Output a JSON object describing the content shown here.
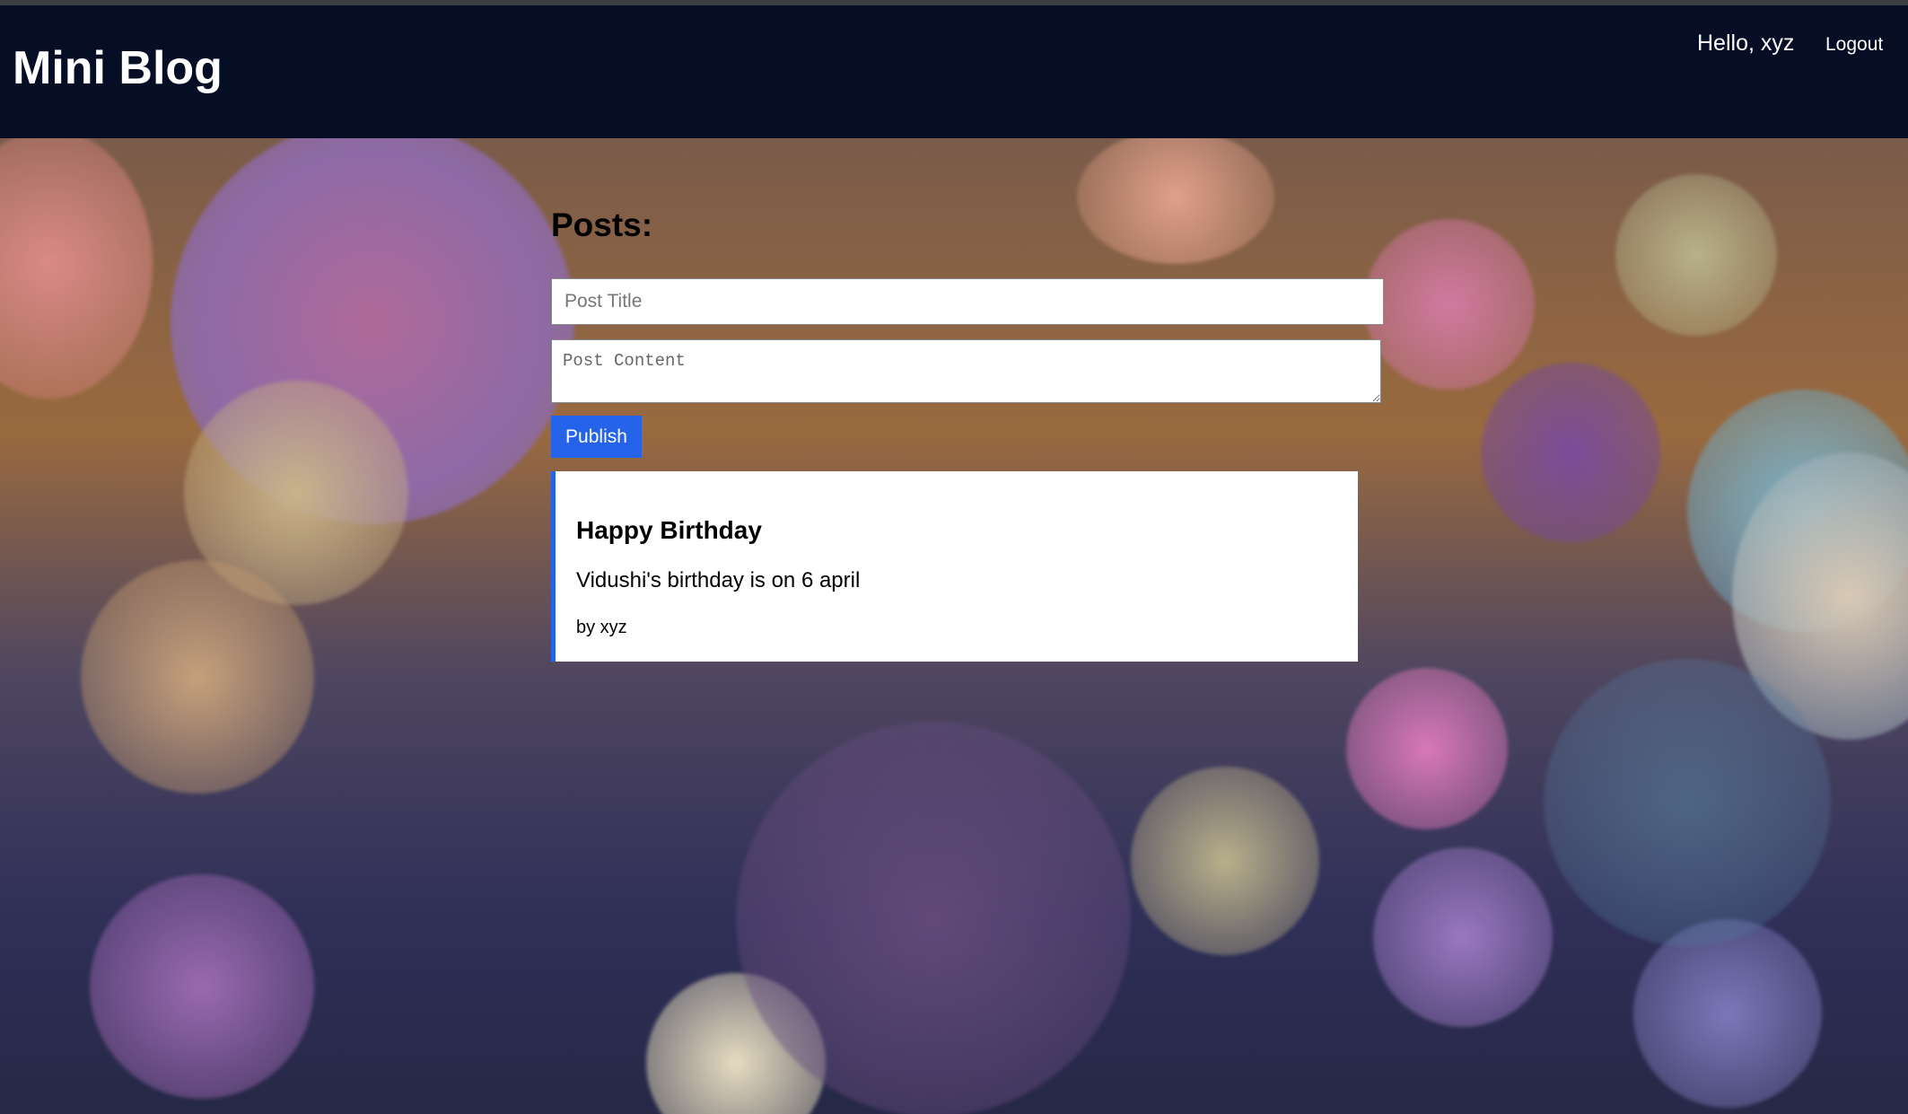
{
  "header": {
    "brand": "Mini Blog",
    "greeting": "Hello, xyz",
    "logout_label": "Logout"
  },
  "main": {
    "heading": "Posts:",
    "title_placeholder": "Post Title",
    "content_placeholder": "Post Content",
    "publish_label": "Publish"
  },
  "posts": [
    {
      "title": "Happy Birthday",
      "body": "Vidushi's birthday is on 6 april",
      "author": "by xyz"
    }
  ],
  "colors": {
    "header_bg": "#050e24",
    "accent": "#2563eb",
    "card_bg": "#ffffff"
  }
}
